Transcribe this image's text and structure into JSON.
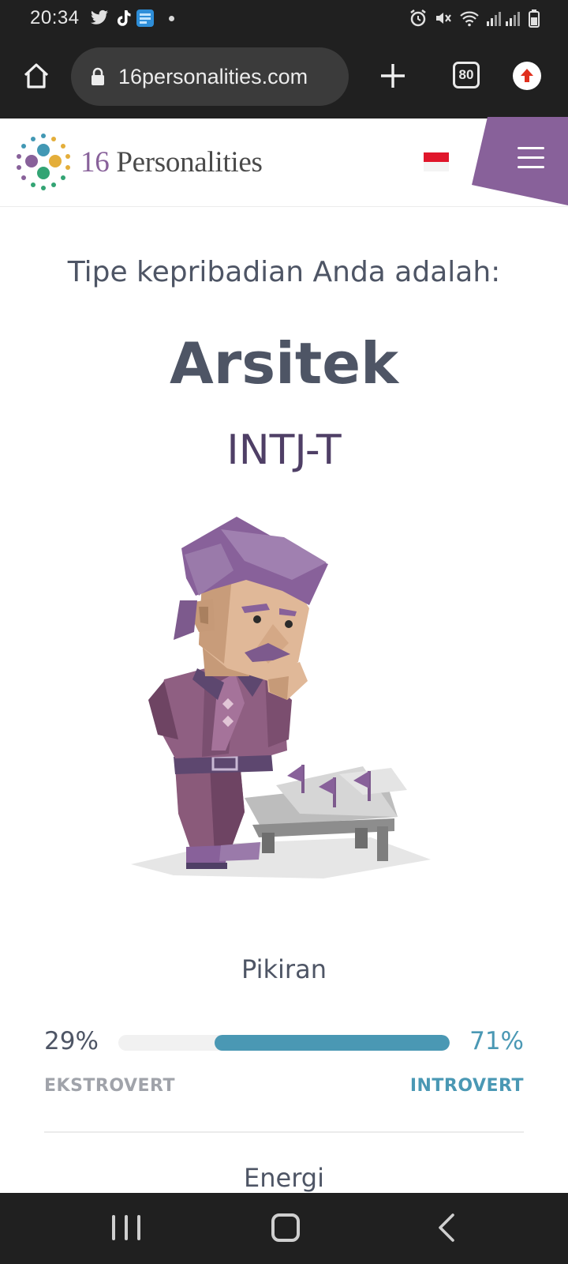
{
  "status_bar": {
    "time": "20:34",
    "left_icons": [
      "twitter-icon",
      "tiktok-icon",
      "word-app-icon"
    ],
    "right_icons": [
      "alarm-icon",
      "mute-icon",
      "wifi-icon",
      "signal-icon",
      "battery-icon"
    ]
  },
  "browser": {
    "url": "16personalities.com",
    "tab_count": "80"
  },
  "site": {
    "brand_number": "16",
    "brand_word": "Personalities",
    "language_flag": "Indonesia"
  },
  "result": {
    "intro": "Tipe kepribadian Anda adalah:",
    "type_name": "Arsitek",
    "type_code": "INTJ-T"
  },
  "traits": [
    {
      "title": "Pikiran",
      "left_percent": "29%",
      "right_percent": "71%",
      "right_share": 0.71,
      "left_label": "EKSTROVERT",
      "right_label": "INTROVERT"
    },
    {
      "title": "Energi"
    }
  ],
  "colors": {
    "accent_blue": "#4a98b4",
    "brand_purple": "#88619a",
    "text_dark": "#4e5565"
  }
}
